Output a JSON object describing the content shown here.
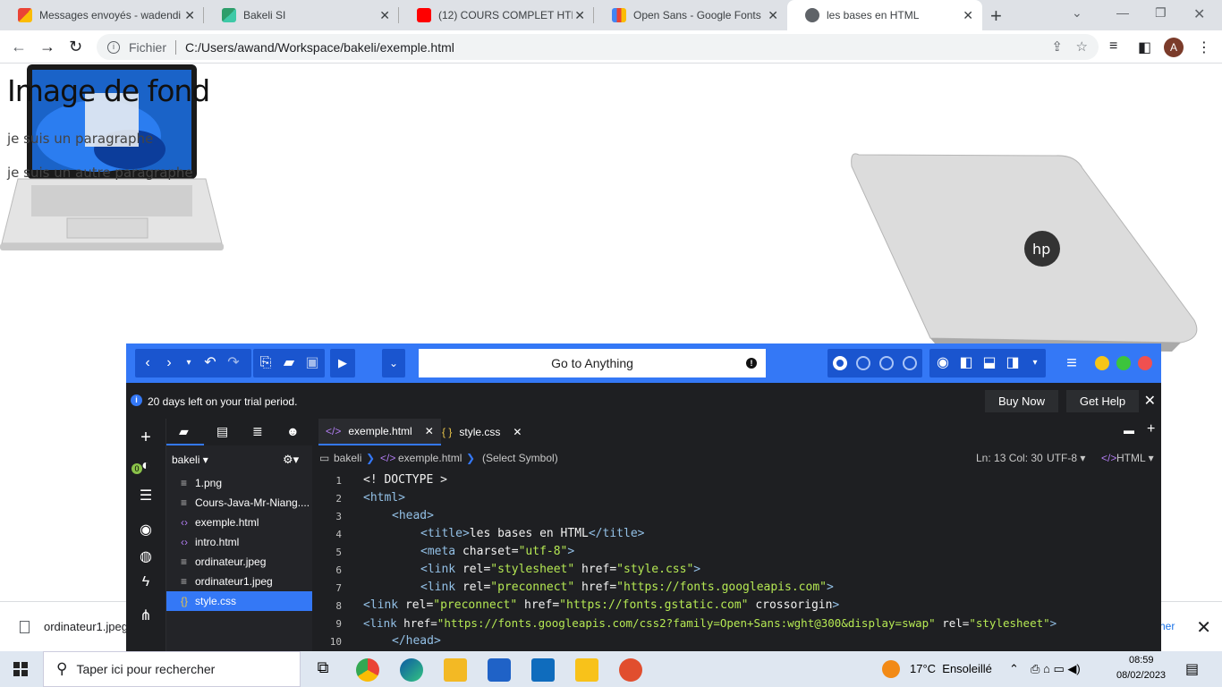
{
  "browser": {
    "tabs": [
      {
        "title": "Messages envoyés - wadendi",
        "favicon": "gmail-icon",
        "close": "✕"
      },
      {
        "title": "Bakeli SI",
        "favicon": "bakeli-icon",
        "close": "✕"
      },
      {
        "title": "(12) COURS COMPLET HTML",
        "favicon": "youtube-icon",
        "close": "✕"
      },
      {
        "title": "Open Sans - Google Fonts",
        "favicon": "google-fonts-icon",
        "close": "✕"
      },
      {
        "title": "les bases en HTML",
        "favicon": "globe-icon",
        "close": "✕",
        "active": true
      }
    ],
    "address_label": "Fichier",
    "url": "C:/Users/awand/Workspace/bakeli/exemple.html",
    "avatar_letter": "A"
  },
  "page": {
    "heading": "Image de fond",
    "paragraph_1": "je suis un paragraphe",
    "paragraph_2": "je suis un autre paragraphe"
  },
  "download_bar": {
    "file": "ordinateur1.jpeg",
    "link_fragment": "her"
  },
  "brackets": {
    "goto_placeholder": "Go to Anything",
    "trial_message": "20 days left on your trial period.",
    "buy_now": "Buy Now",
    "get_help": "Get Help",
    "file_tabs": [
      {
        "name": "exemple.html",
        "icon": "html-code-icon"
      },
      {
        "name": "style.css",
        "icon": "css-braces-icon"
      }
    ],
    "project": "bakeli",
    "badge_count": "0",
    "files": [
      {
        "name": "1.png",
        "icon": "file-icon"
      },
      {
        "name": "Cours-Java-Mr-Niang....",
        "icon": "file-icon"
      },
      {
        "name": "exemple.html",
        "icon": "html-code-icon"
      },
      {
        "name": "intro.html",
        "icon": "html-code-icon"
      },
      {
        "name": "ordinateur.jpeg",
        "icon": "file-icon"
      },
      {
        "name": "ordinateur1.jpeg",
        "icon": "file-icon"
      },
      {
        "name": "style.css",
        "icon": "css-braces-icon",
        "selected": true
      }
    ],
    "breadcrumb": {
      "folder": "bakeli",
      "file": "exemple.html",
      "symbol": "(Select Symbol)"
    },
    "status": {
      "position": "Ln: 13 Col: 30",
      "encoding": "UTF-8",
      "language": "HTML"
    },
    "code_lines": [
      "1",
      "2",
      "3",
      "4",
      "5",
      "6",
      "7",
      "8",
      "9",
      "10"
    ],
    "code": {
      "l1": "<! DOCTYPE >",
      "l2": "<html>",
      "l3": "<head>",
      "l4_open": "<title>",
      "l4_text": "les bases en HTML",
      "l4_close": "</title>",
      "l5_tag": "<meta",
      "l5_attr": " charset=",
      "l5_val": "\"utf-8\"",
      "l5_end": ">",
      "l6_tag": "<link",
      "l6_a1": " rel=",
      "l6_v1": "\"stylesheet\"",
      "l6_a2": " href=",
      "l6_v2": "\"style.css\"",
      "l6_end": ">",
      "l7_tag": "<link",
      "l7_a1": " rel=",
      "l7_v1": "\"preconnect\"",
      "l7_a2": " href=",
      "l7_v2": "\"https://fonts.googleapis.com\"",
      "l7_end": ">",
      "l8_tag": "<link",
      "l8_a1": " rel=",
      "l8_v1": "\"preconnect\"",
      "l8_a2": " href=",
      "l8_v2": "\"https://fonts.gstatic.com\"",
      "l8_a3": " crossorigin",
      "l8_end": ">",
      "l9_tag": "<link",
      "l9_a1": " href=",
      "l9_v1": "\"https://fonts.googleapis.com/css2?family=Open+Sans:wght@300&display=swap\"",
      "l9_a2": " rel=",
      "l9_v2": "\"stylesheet\"",
      "l9_end": ">",
      "l10": "</head>"
    }
  },
  "taskbar": {
    "search_placeholder": "Taper ici pour rechercher",
    "weather": "17°C  Ensoleillé",
    "time": "08:59",
    "date": "08/02/2023"
  },
  "colors": {
    "brackets_blue": "#3478f6",
    "chrome_tabstrip": "#dee1e6"
  }
}
